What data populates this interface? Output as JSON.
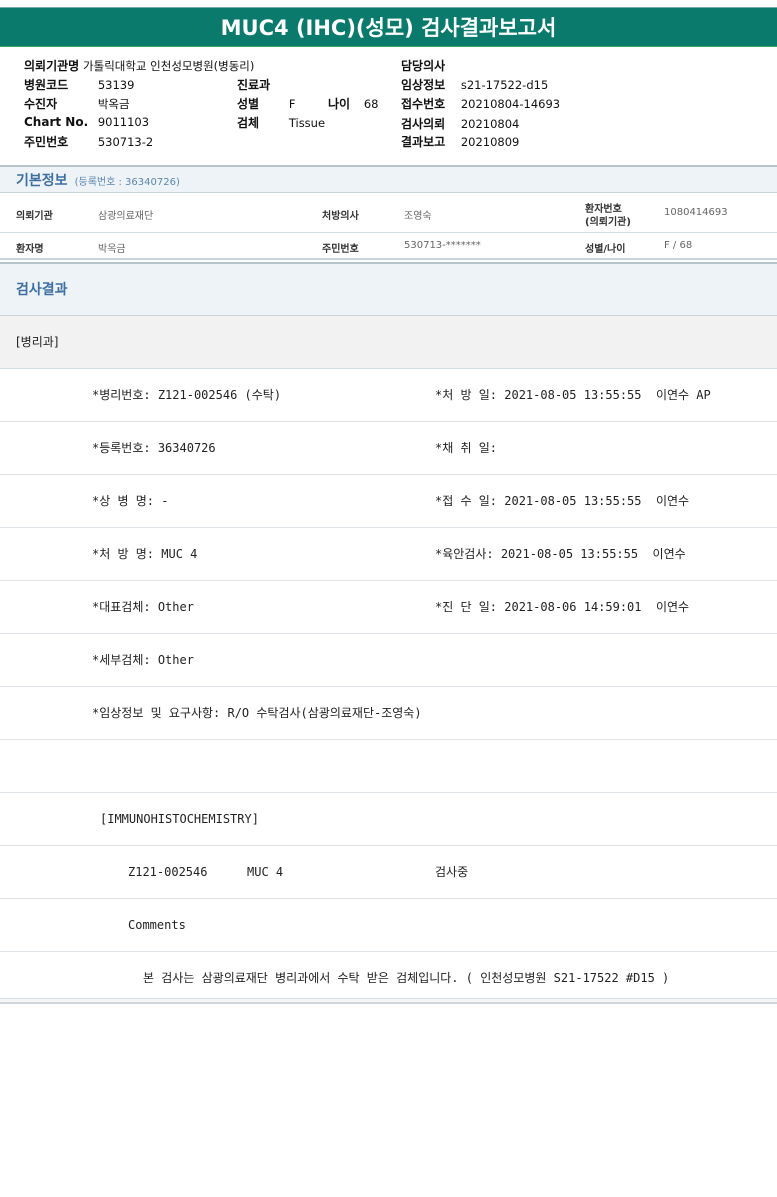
{
  "report": {
    "title": "MUC4 (IHC)(성모) 검사결과보고서"
  },
  "header": {
    "institution_label": "의뢰기관명",
    "institution_value": "가톨릭대학교 인천성모병원(병동리)",
    "hospital_code_label": "병원코드",
    "hospital_code_value": "53139",
    "recipient_label": "수진자",
    "recipient_value": "박옥금",
    "chart_no_label": "Chart No.",
    "chart_no_value": "9011103",
    "resident_no_label": "주민번호",
    "resident_no_value": "530713-2",
    "department_label": "진료과",
    "department_value": "",
    "sex_label": "성별",
    "sex_value": "F",
    "age_label": "나이",
    "age_value": "68",
    "specimen_label": "검체",
    "specimen_value": "Tissue",
    "doctor_label": "담당의사",
    "doctor_value": "",
    "clinical_label": "임상정보",
    "clinical_value": "s21-17522-d15",
    "receipt_no_label": "접수번호",
    "receipt_no_value": "20210804-14693",
    "request_label": "검사의뢰",
    "request_value": "20210804",
    "report_label": "결과보고",
    "report_value": "20210809"
  },
  "basic_info": {
    "title": "기본정보",
    "subtitle": "(등록번호 : 36340726)",
    "row1": {
      "institution_label": "의뢰기관",
      "institution_value": "삼광의료재단",
      "doctor_label": "처방의사",
      "doctor_value": "조영숙",
      "patient_no_label": "환자번호",
      "patient_no_label2": "(의뢰기관)",
      "patient_no_value": "1080414693"
    },
    "row2": {
      "name_label": "환자명",
      "name_value": "박옥금",
      "resident_label": "주민번호",
      "resident_value": "530713-*******",
      "sex_age_label": "성별/나이",
      "sex_age_value": "F / 68"
    }
  },
  "results": {
    "title": "검사결과",
    "department": "[병리과]",
    "rows": [
      {
        "left": "*병리번호: Z121-002546 (수탁)",
        "right": "*처 방 일: 2021-08-05 13:55:55  이연수 AP"
      },
      {
        "left": "*등록번호: 36340726",
        "right": "*채 취 일:"
      },
      {
        "left": "*상 병 명: -",
        "right": "*접 수 일: 2021-08-05 13:55:55  이연수"
      },
      {
        "left": "*처 방 명: MUC 4",
        "right": "*육안검사: 2021-08-05 13:55:55  이연수"
      },
      {
        "left": "*대표검체: Other",
        "right": "*진 단 일: 2021-08-06 14:59:01  이연수"
      },
      {
        "left": "*세부검체: Other",
        "right": ""
      },
      {
        "left": "*임상정보 및 요구사항: R/O 수탁검사(삼광의료재단-조영숙)",
        "right": ""
      }
    ],
    "ihc_header": "[IMMUNOHISTOCHEMISTRY]",
    "ihc_row": {
      "id": "Z121-002546",
      "test": "MUC 4",
      "status": "검사중"
    },
    "comments_label": "Comments",
    "comment_text": "본 검사는 삼광의료재단 병리과에서 수탁 받은 검체입니다. ( 인천성모병원 S21-17522 #D15 )"
  }
}
